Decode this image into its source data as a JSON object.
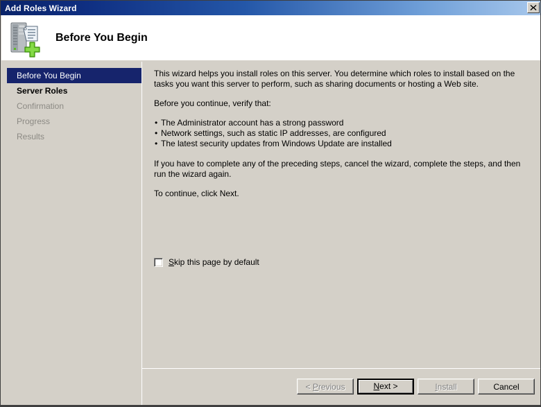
{
  "window": {
    "title": "Add Roles Wizard",
    "close_icon": "close-icon"
  },
  "header": {
    "title": "Before You Begin",
    "icon": "server-add-role-icon"
  },
  "sidebar": {
    "items": [
      {
        "label": "Before You Begin",
        "state": "active"
      },
      {
        "label": "Server Roles",
        "state": "pending"
      },
      {
        "label": "Confirmation",
        "state": "disabled"
      },
      {
        "label": "Progress",
        "state": "disabled"
      },
      {
        "label": "Results",
        "state": "disabled"
      }
    ]
  },
  "content": {
    "intro": "This wizard helps you install roles on this server. You determine which roles to install based on the tasks you want this server to perform, such as sharing documents or hosting a Web site.",
    "verify_heading": "Before you continue, verify that:",
    "verify_items": [
      "The Administrator account has a strong password",
      "Network settings, such as static IP addresses, are configured",
      "The latest security updates from Windows Update are installed"
    ],
    "cancel_note": "If you have to complete any of the preceding steps, cancel the wizard, complete the steps, and then run the wizard again.",
    "continue_note": "To continue, click Next.",
    "skip_checkbox": {
      "accel": "S",
      "label_rest": "kip this page by default",
      "checked": false
    }
  },
  "footer": {
    "buttons": [
      {
        "name": "previous",
        "prefix": "< ",
        "accel": "P",
        "suffix": "revious",
        "disabled": true
      },
      {
        "name": "next",
        "prefix": "",
        "accel": "N",
        "suffix": "ext >",
        "disabled": false
      },
      {
        "name": "install",
        "prefix": "",
        "accel": "I",
        "suffix": "nstall",
        "disabled": true
      },
      {
        "name": "cancel",
        "prefix": "",
        "accel": "",
        "suffix": "Cancel",
        "disabled": false
      }
    ]
  },
  "colors": {
    "titlebar_start": "#0a246a",
    "titlebar_end": "#a8c8ec",
    "nav_active_bg": "#16246c",
    "dialog_bg": "#d4d0c8",
    "disabled_text": "#8c8a84",
    "accent_green": "#5dbb28"
  }
}
